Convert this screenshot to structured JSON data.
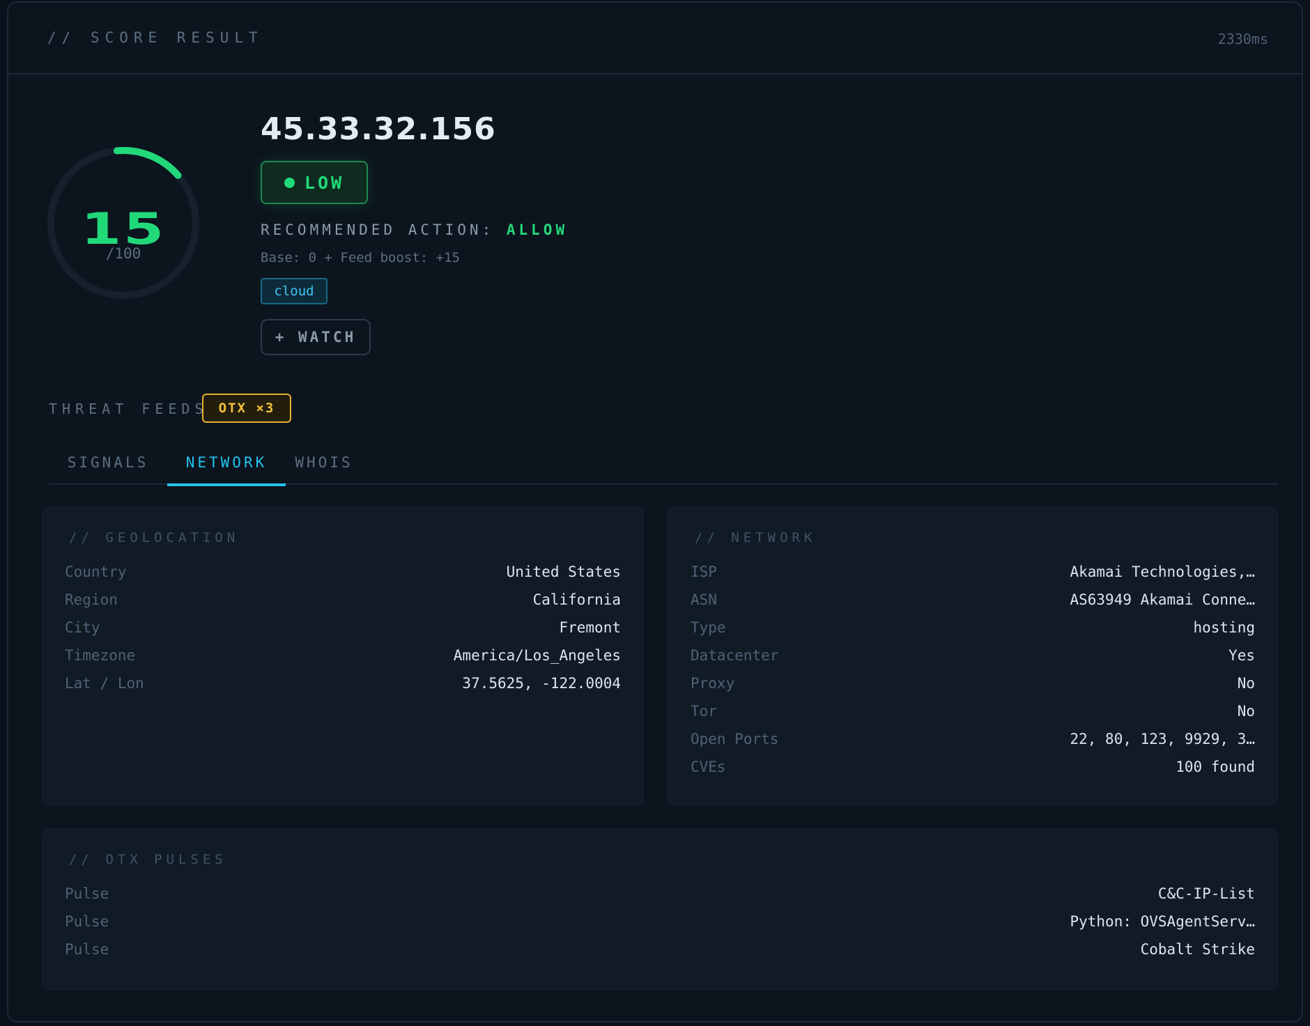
{
  "header": {
    "title": "// SCORE RESULT",
    "time": "2330ms"
  },
  "score": {
    "value": "15",
    "max": "/100",
    "fraction": 0.15
  },
  "ip": "45.33.32.156",
  "level": "LOW",
  "recommendation": {
    "label": "RECOMMENDED ACTION:",
    "action": "ALLOW"
  },
  "base_text": "Base: 0 + Feed boost: +15",
  "tags": [
    "cloud"
  ],
  "watch_label": "+ WATCH",
  "feeds": {
    "label": "THREAT FEEDS:",
    "badge": "OTX ×3"
  },
  "tabs": [
    {
      "label": "SIGNALS",
      "active": false
    },
    {
      "label": "NETWORK",
      "active": true
    },
    {
      "label": "WHOIS",
      "active": false
    }
  ],
  "geolocation": {
    "title": "// GEOLOCATION",
    "rows": [
      {
        "k": "Country",
        "v": "United States"
      },
      {
        "k": "Region",
        "v": "California"
      },
      {
        "k": "City",
        "v": "Fremont"
      },
      {
        "k": "Timezone",
        "v": "America/Los_Angeles"
      },
      {
        "k": "Lat / Lon",
        "v": "37.5625, -122.0004"
      }
    ]
  },
  "network": {
    "title": "// NETWORK",
    "rows": [
      {
        "k": "ISP",
        "v": "Akamai Technologies,…"
      },
      {
        "k": "ASN",
        "v": "AS63949 Akamai Conne…"
      },
      {
        "k": "Type",
        "v": "hosting"
      },
      {
        "k": "Datacenter",
        "v": "Yes"
      },
      {
        "k": "Proxy",
        "v": "No"
      },
      {
        "k": "Tor",
        "v": "No"
      },
      {
        "k": "Open Ports",
        "v": "22, 80, 123, 9929, 3…"
      },
      {
        "k": "CVEs",
        "v": "100 found"
      }
    ]
  },
  "otx": {
    "title": "// OTX PULSES",
    "rows": [
      {
        "k": "Pulse",
        "v": "C&C-IP-List"
      },
      {
        "k": "Pulse",
        "v": "Python: OVSAgentServ…"
      },
      {
        "k": "Pulse",
        "v": "Cobalt Strike"
      }
    ]
  },
  "colors": {
    "accent_green": "#22d97a",
    "accent_cyan": "#22c3ee",
    "accent_amber": "#f3c23a"
  }
}
